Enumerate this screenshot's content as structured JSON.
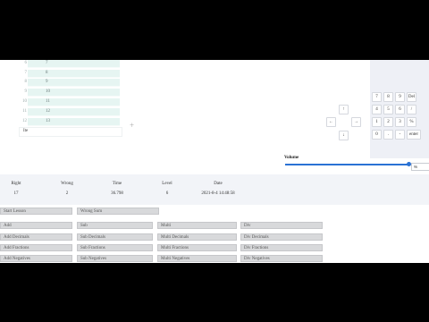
{
  "sheet": {
    "rows": [
      {
        "num": "6",
        "val": "7"
      },
      {
        "num": "7",
        "val": "8"
      },
      {
        "num": "8",
        "val": "9"
      },
      {
        "num": "9",
        "val": "10"
      },
      {
        "num": "10",
        "val": "11"
      },
      {
        "num": "11",
        "val": "12"
      },
      {
        "num": "12",
        "val": "13"
      }
    ],
    "entry_value": "Ite"
  },
  "keypad": {
    "row1": [
      "7",
      "8",
      "9",
      "Del"
    ],
    "row2": [
      "4",
      "5",
      "6",
      "/"
    ],
    "row3": [
      "1",
      "2",
      "3",
      "%"
    ],
    "row4": [
      "0",
      ".",
      "-",
      "enter"
    ],
    "arrows": {
      "up": "↑",
      "left": "←",
      "right": "→",
      "down": "↓"
    }
  },
  "volume": {
    "label": "Volume",
    "value_text": "96",
    "level_fraction": 0.86
  },
  "stats": {
    "headers": [
      "Right",
      "Wrong",
      "Time",
      "Level",
      "Date"
    ],
    "values": [
      "17",
      "2",
      "36.798",
      "6",
      "2021-8-4 14:48:58"
    ]
  },
  "buttons": {
    "row0": [
      "Start Lesson",
      "Wrong Sum"
    ],
    "grid": [
      [
        "Add",
        "Sub",
        "Multi",
        "Div"
      ],
      [
        "Add Decimals",
        "Sub Decimals",
        "Multi Decimals",
        "Div Decimals"
      ],
      [
        "Add Fractions",
        "Sub Fractions",
        "Multi Fractions",
        "Div Fractions"
      ],
      [
        "Add Negatives",
        "Sub Negatives",
        "Multi Negatives",
        "Div Negatives"
      ]
    ]
  },
  "colors": {
    "accent": "#2a72d4",
    "row_fill": "#e6f5f2",
    "button": "#d8d9db"
  }
}
